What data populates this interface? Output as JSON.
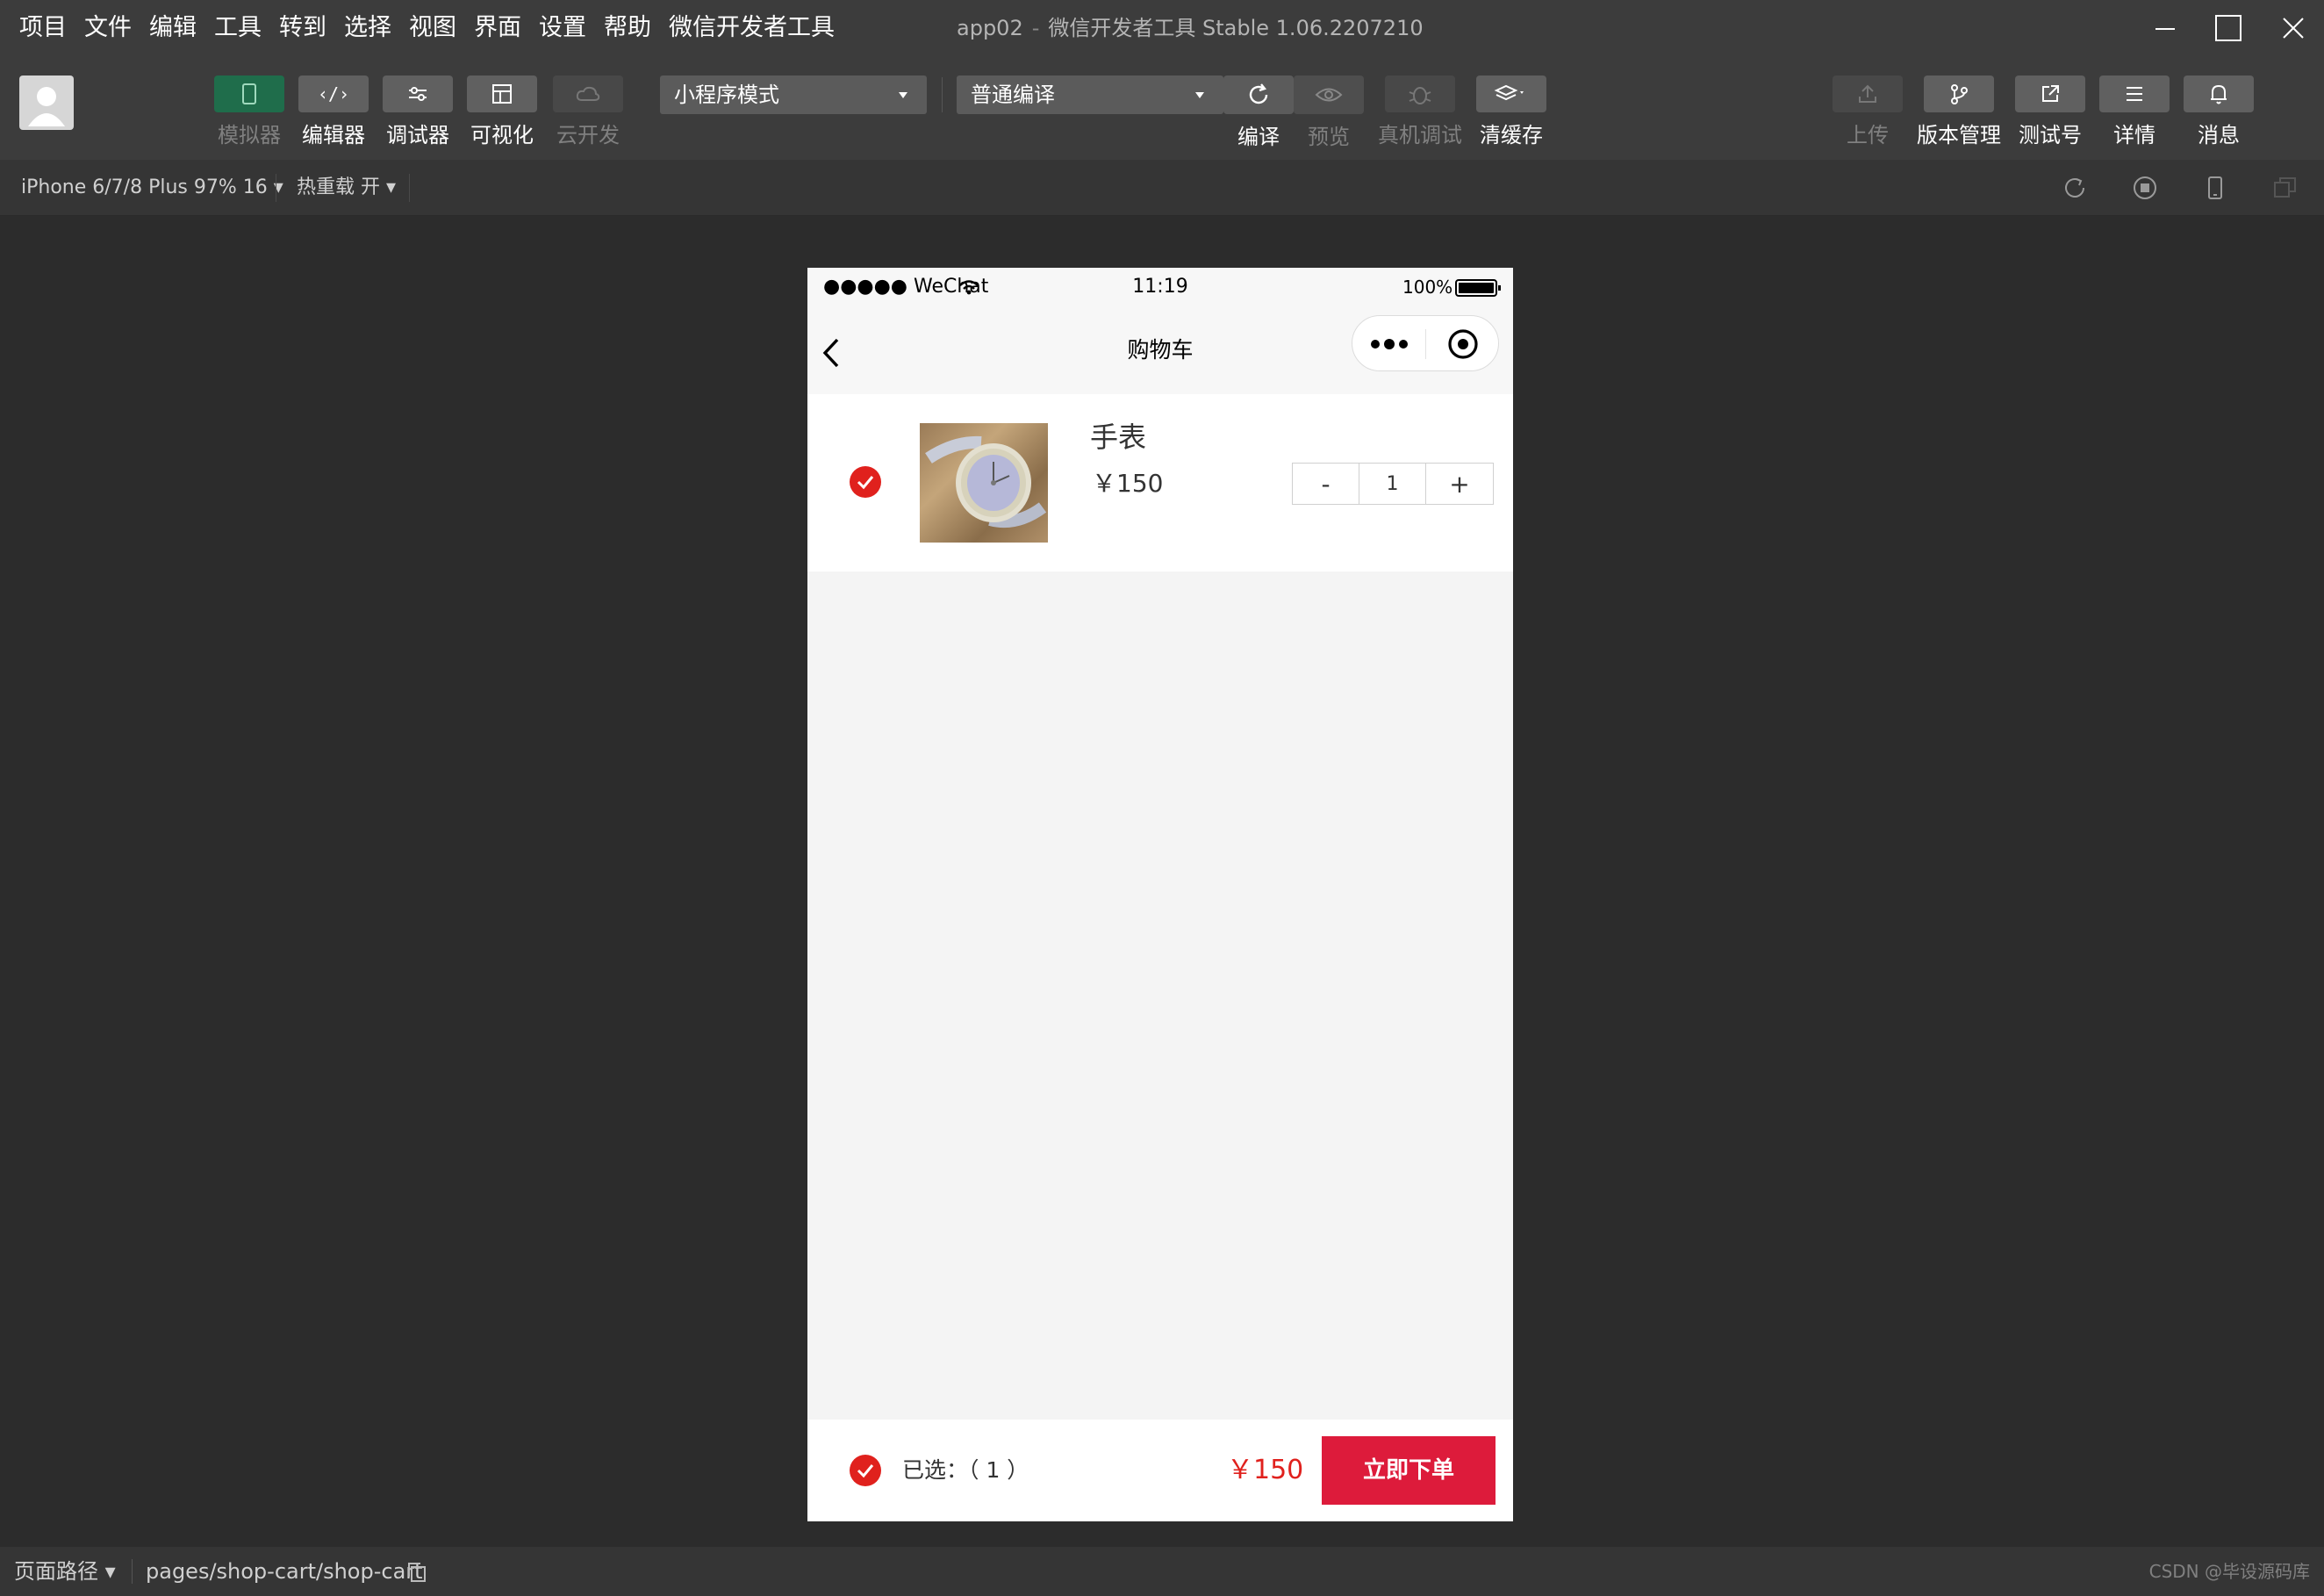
{
  "menu": {
    "items": [
      "项目",
      "文件",
      "编辑",
      "工具",
      "转到",
      "选择",
      "视图",
      "界面",
      "设置",
      "帮助",
      "微信开发者工具"
    ]
  },
  "window": {
    "title_app": "app02",
    "title_sep": "-",
    "title_rest": "微信开发者工具 Stable 1.06.2207210"
  },
  "toolbar": {
    "simulator": "模拟器",
    "editor": "编辑器",
    "debugger": "调试器",
    "visual": "可视化",
    "cloud": "云开发",
    "mode_select": "小程序模式",
    "compile_select": "普通编译",
    "compile": "编译",
    "preview": "预览",
    "remote_debug": "真机调试",
    "clear_cache": "清缓存",
    "upload": "上传",
    "version_mgmt": "版本管理",
    "test_account": "测试号",
    "details": "详情",
    "messages": "消息"
  },
  "subbar": {
    "device": "iPhone 6/7/8 Plus 97% 16 ▾",
    "hot_reload": "热重载 开 ▾"
  },
  "phone": {
    "status": {
      "carrier": "●●●●● WeChat",
      "time": "11:19",
      "battery": "100%"
    },
    "nav_title": "购物车",
    "cart": {
      "items": [
        {
          "name": "手表",
          "price": "￥150",
          "qty": "1",
          "minus": "-",
          "plus": "+"
        }
      ]
    },
    "footer": {
      "selected": "已选：（ 1 ）",
      "total": "￥150",
      "order_button": "立即下单"
    }
  },
  "bottombar": {
    "page_path_label": "页面路径 ▾",
    "path": "pages/shop-cart/shop-cart",
    "watermark": "CSDN @毕设源码库"
  },
  "colors": {
    "accent_red": "#e0211d",
    "order_button": "#dd1b3b",
    "simulator_active": "#1f6d4b"
  }
}
